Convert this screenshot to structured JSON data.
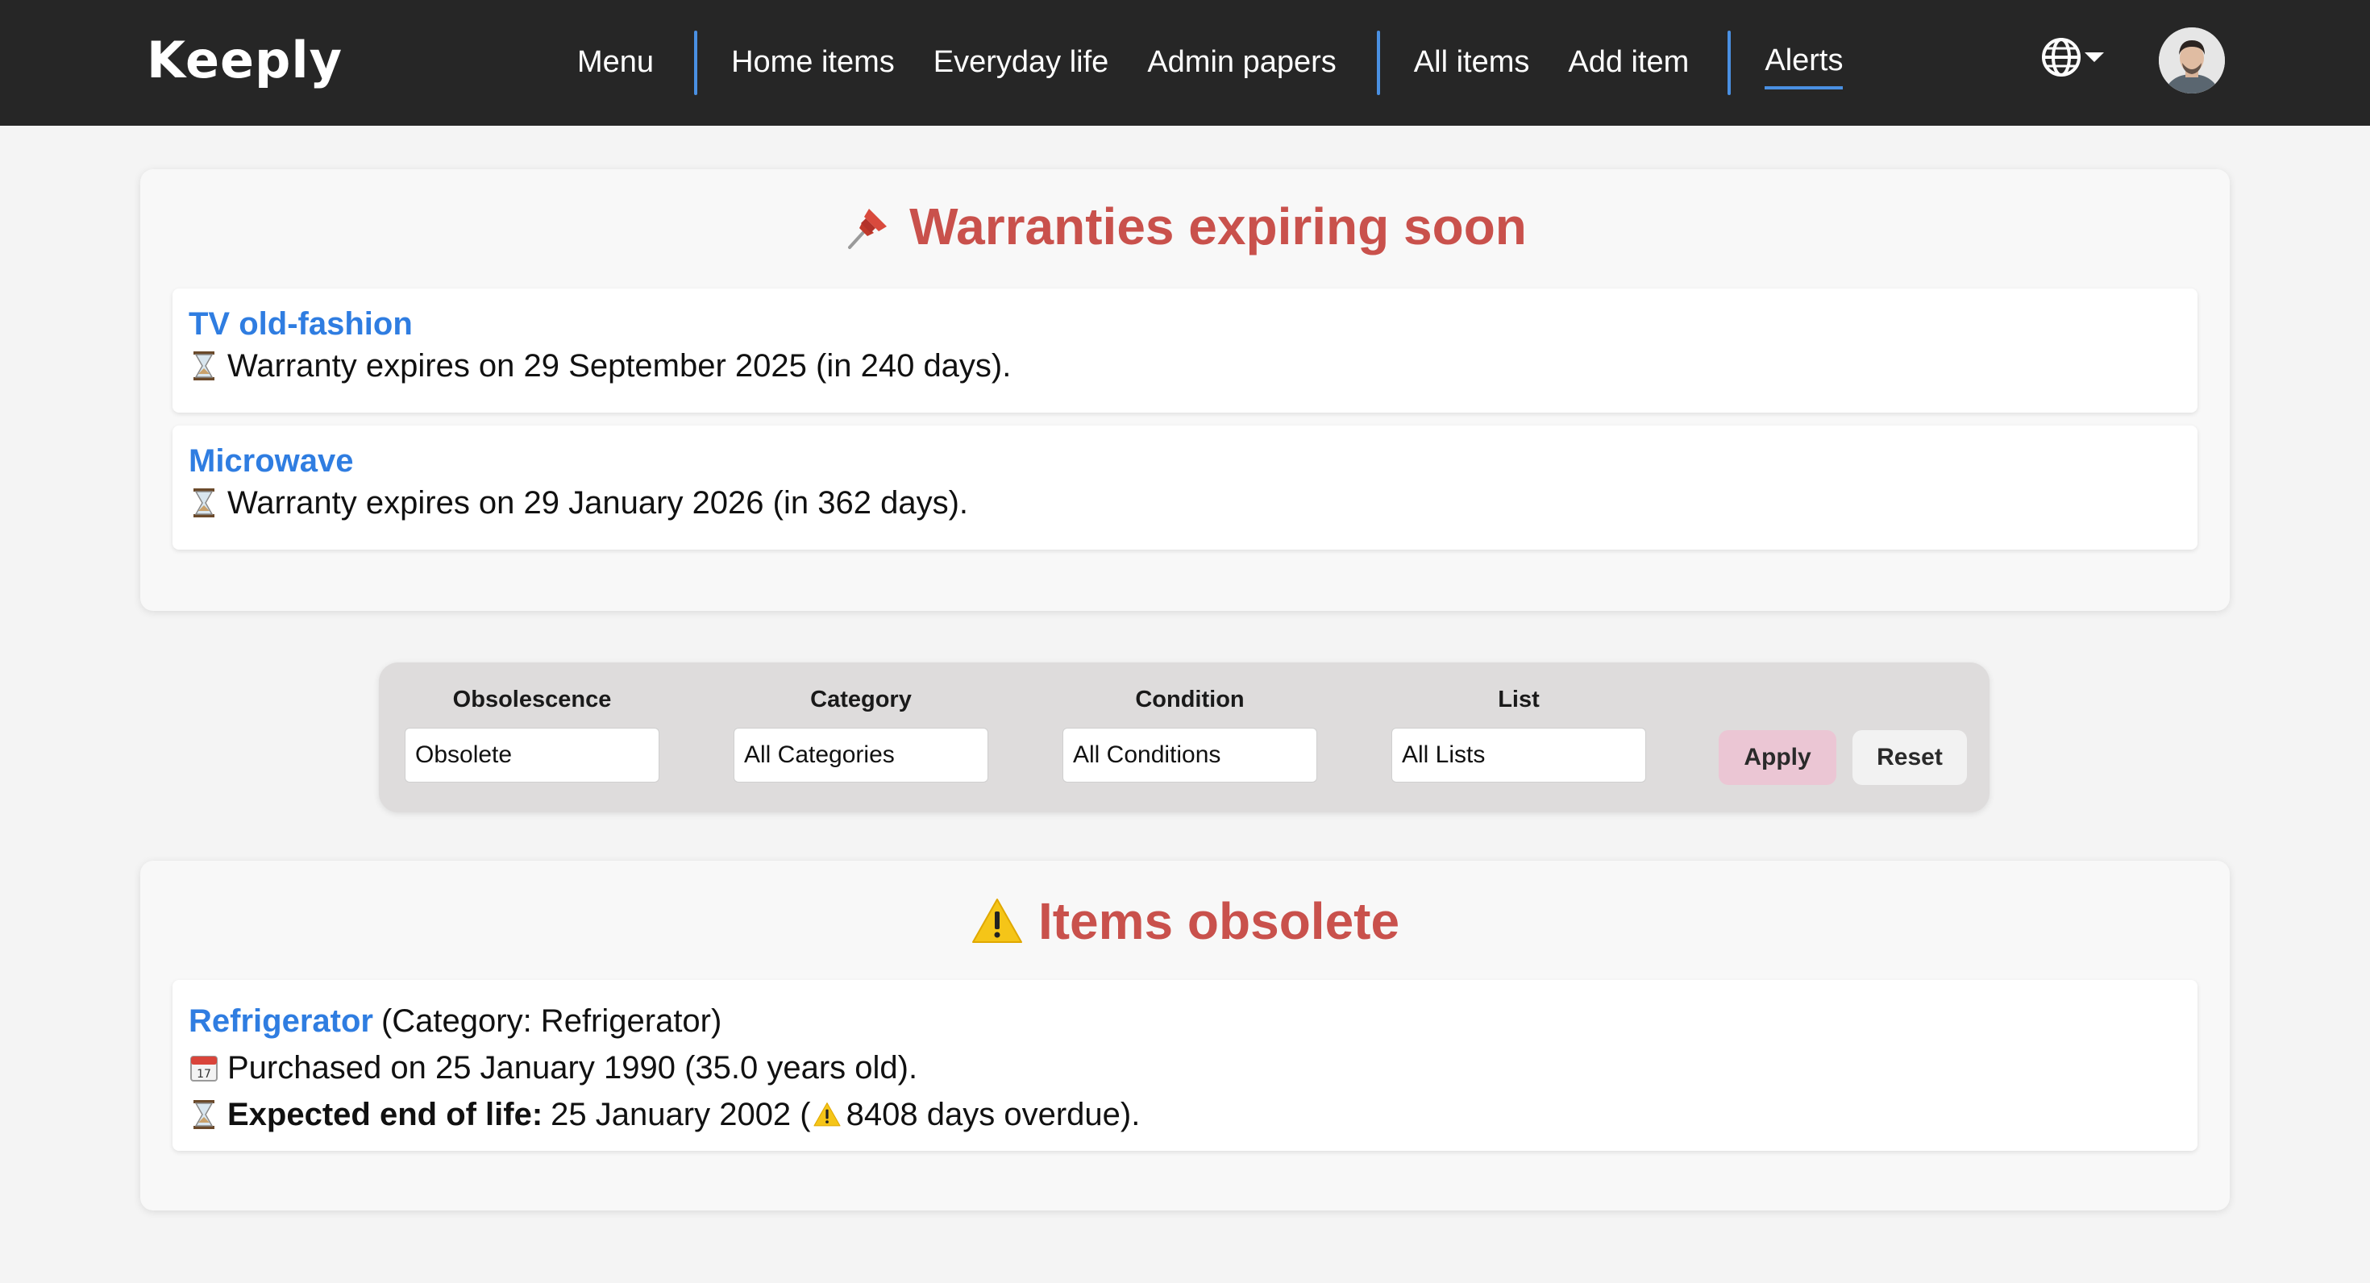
{
  "header": {
    "logo": "Keeply",
    "nav": {
      "menu": "Menu",
      "home_items": "Home items",
      "everyday_life": "Everyday life",
      "admin_papers": "Admin papers",
      "all_items": "All items",
      "add_item": "Add item",
      "alerts": "Alerts"
    },
    "language_icon": "globe-icon",
    "accent_color": "#4a90e2"
  },
  "warranties": {
    "title": "Warranties expiring soon",
    "icon": "pushpin-icon",
    "items": [
      {
        "name": "TV old-fashion",
        "text": "Warranty expires on 29 September 2025 (in 240 days)."
      },
      {
        "name": "Microwave",
        "text": "Warranty expires on 29 January 2026 (in 362 days)."
      }
    ]
  },
  "filters": {
    "obsolescence": {
      "label": "Obsolescence",
      "value": "Obsolete"
    },
    "category": {
      "label": "Category",
      "value": "All Categories"
    },
    "condition": {
      "label": "Condition",
      "value": "All Conditions"
    },
    "list": {
      "label": "List",
      "value": "All Lists"
    },
    "apply": "Apply",
    "reset": "Reset"
  },
  "obsolete": {
    "title": "Items obsolete",
    "icon": "warning-icon",
    "items": [
      {
        "name": "Refrigerator",
        "category_text": "(Category: Refrigerator)",
        "purchased_text": "Purchased on 25 January 1990 (35.0 years old).",
        "eol_label": "Expected end of life:",
        "eol_date": "25 January 2002 (",
        "overdue_text": "8408 days overdue)."
      }
    ]
  },
  "colors": {
    "title_red": "#c9514c",
    "link_blue": "#2f7de1",
    "nav_bg": "#262626",
    "apply_bg": "#ebc6d4"
  }
}
